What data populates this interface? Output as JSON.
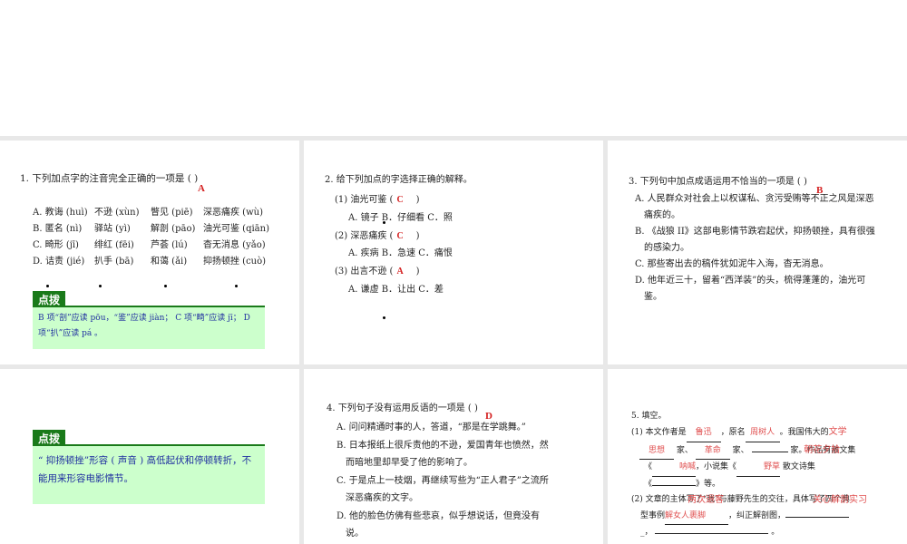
{
  "q1": {
    "title": "1. 下列加点字的注音完全正确的一项是 (          )",
    "answer": "A",
    "rows": [
      [
        "A. 教诲 (huì)",
        "不逊 (xùn)",
        "瞥见 (piē)",
        "深恶痛疾 (wù)"
      ],
      [
        "B. 匿名 (nì)",
        "驿站 (yì)",
        "解剖 (pāo)",
        "油光可鉴 (qiān)"
      ],
      [
        "C. 畸形 (jī)",
        "绯红 (fēi)",
        "芦荟 (lú)",
        "杳无消息 (yǎo)"
      ],
      [
        "D. 诘责 (jié)",
        "扒手 (bā)",
        "和蔼 (ǎi)",
        "抑扬顿挫 (cuò)"
      ]
    ],
    "hint_label": "点拨",
    "hint": "B 项“剖”应读 pōu，“鉴”应读 jiàn；  C 项“畸”应读 jī；  D 项“扒”应读 pá 。"
  },
  "q2": {
    "title": "2. 给下列加点的字选择正确的解释。",
    "items": [
      {
        "q": "(1) 油光可鉴 (",
        "ans": "C",
        "opts": "A. 镜子   B．仔细看    C．照"
      },
      {
        "q": "(2) 深恶痛疾 (",
        "ans": "C",
        "opts": "A. 疾病    B．急速      C．痛恨"
      },
      {
        "q": "(3) 出言不逊 (",
        "ans": "A",
        "opts": "A. 谦虚    B．让出      C．差"
      }
    ],
    "close": ")"
  },
  "q3": {
    "title": "3. 下列句中加点成语运用不恰当的一项是 (          )",
    "answer": "B",
    "lines": [
      "A. 人民群众对社会上以权谋私、贪污受贿等不正之风是深恶",
      "痛疾的。",
      "B. 《战狼 II》这部电影情节跌宕起伏，抑扬顿挫，具有很强",
      "的感染力。",
      "C. 那些寄出去的稿件犹如泥牛入海，杳无消息。",
      "D. 他年近三十，留着“西洋装”的头，梳得蓬蓬的，油光可",
      "鉴。"
    ]
  },
  "q3hint": {
    "label": "点拨",
    "text": "“ 抑扬顿挫”形容 ( 声音 ) 高低起伏和停顿转折，不能用来形容电影情节。"
  },
  "q4": {
    "title": "4. 下列句子没有运用反语的一项是 (          )",
    "answer": "D",
    "lines": [
      "A. 问问精通时事的人，答道，“那是在学跳舞。”",
      "B. 日本报纸上很斥责他的不逊，爱国青年也愤然，然",
      "而暗地里却早受了他的影响了。",
      "C. 于是点上一枝烟，再继续写些为“正人君子”之流所",
      "深恶痛疾的文字。",
      "D. 他的脸色仿佛有些悲哀，似乎想说话，但竟没有",
      "说。"
    ]
  },
  "q5": {
    "title": "5. 填空。",
    "l1a": "(1) 本文作者是",
    "a1": "鲁迅",
    "l1b": "，原名",
    "a2": "周树人",
    "l1c": "。我国伟大的",
    "a3": "文学",
    "a4": "思想",
    "l2a": "家、",
    "a5": "革命",
    "l2b": "家、",
    "l2c": "家。作品有散文集",
    "a6": "朝花夕拾",
    "l3a": "《",
    "a7": "呐喊",
    "l3b": "，小说集《",
    "a8": "野草",
    "l3c": "散文诗集",
    "l4a": "《",
    "l4b": "》等。",
    "l5a": "(2) 文章的主体写了“我”与藤野先生的交往，具体写了四个典",
    "a9": "两次退客",
    "a10": "关心解剖实习",
    "l6a": "型事例",
    "a11": "解女人裹脚",
    "l6b": "，纠正解剖图，",
    "l7a": "_，",
    "l7b": "。"
  }
}
